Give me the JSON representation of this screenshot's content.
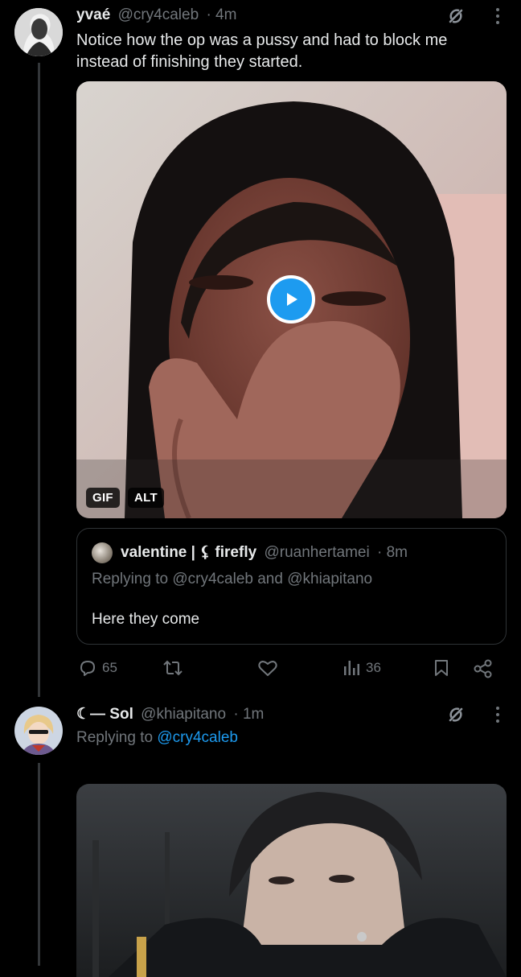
{
  "tweet1": {
    "display_name": "yvaé",
    "handle": "@cry4caleb",
    "time": "· 4m",
    "text": "Notice how the op was a pussy and had to block me instead of finishing they started.",
    "media_badges": {
      "gif": "GIF",
      "alt": "ALT"
    },
    "quote": {
      "display_name": "valentine | ⚸ firefly",
      "handle": "@ruanhertamei",
      "time": "· 8m",
      "replying_prefix": "Replying to",
      "replying_user1": "@cry4caleb",
      "replying_and": "and",
      "replying_user2": "@khiapitano",
      "text": "Here they come"
    },
    "actions": {
      "replies": "65",
      "views": "36"
    }
  },
  "tweet2": {
    "display_name": "☾— Sol",
    "handle": "@khiapitano",
    "time": "· 1m",
    "replying_prefix": "Replying to",
    "replying_user": "@cry4caleb"
  },
  "colors": {
    "background": "#000000",
    "text": "#e7e9ea",
    "muted": "#71767b",
    "link": "#1d9bf0",
    "play_button": "#1d9bf0"
  },
  "icons": [
    "grok-icon",
    "more-icon",
    "reply-icon",
    "retweet-icon",
    "like-icon",
    "views-icon",
    "bookmark-icon",
    "share-icon",
    "play-icon"
  ]
}
